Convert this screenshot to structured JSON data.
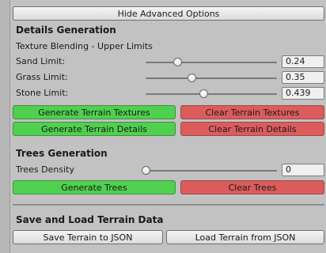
{
  "toggle_button": "Hide Advanced Options",
  "details": {
    "heading": "Details Generation",
    "subheading": "Texture Blending - Upper Limits",
    "sliders": [
      {
        "label": "Sand Limit:",
        "value": "0.24",
        "fraction": 0.24
      },
      {
        "label": "Grass Limit:",
        "value": "0.35",
        "fraction": 0.35
      },
      {
        "label": "Stone Limit:",
        "value": "0.439",
        "fraction": 0.439
      }
    ],
    "generate_textures": "Generate Terrain Textures",
    "clear_textures": "Clear Terrain Textures",
    "generate_details": "Generate Terrain Details",
    "clear_details": "Clear Terrain Details"
  },
  "trees": {
    "heading": "Trees Generation",
    "density_label": "Trees Density",
    "density_value": "0",
    "density_fraction": 0,
    "generate": "Generate Trees",
    "clear": "Clear Trees"
  },
  "save_load": {
    "heading": "Save and Load Terrain Data",
    "save": "Save Terrain to JSON",
    "load": "Load Terrain from JSON"
  },
  "colors": {
    "generate": "#4fd04f",
    "clear": "#dc5c5c"
  }
}
